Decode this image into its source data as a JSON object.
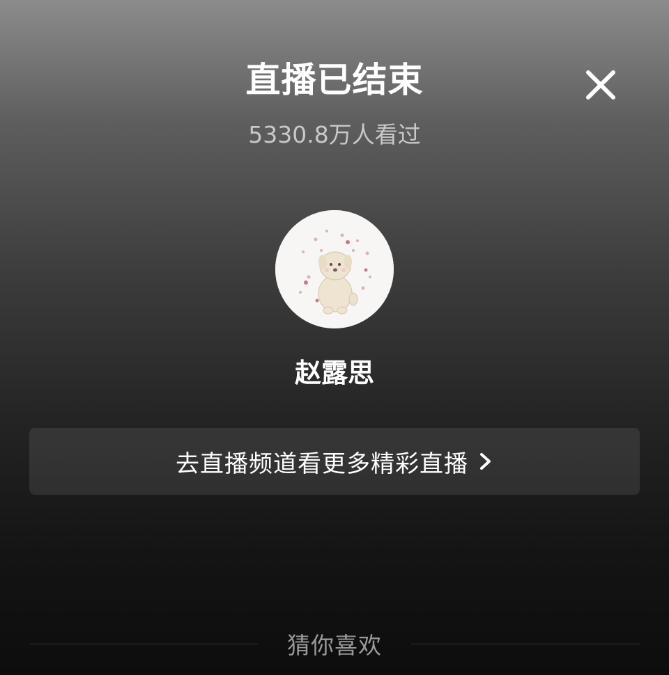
{
  "header": {
    "title": "直播已结束",
    "viewers": "5330.8万人看过",
    "close_icon": "close-icon"
  },
  "streamer": {
    "name": "赵露思",
    "avatar_icon": "avatar-illustration-dog"
  },
  "channel_button": {
    "label": "去直播频道看更多精彩直播",
    "icon": "chevron-right-icon"
  },
  "recommend": {
    "label": "猜你喜欢"
  },
  "colors": {
    "background_top": "#8c8c8c",
    "background_bottom": "#0d0d0d",
    "subtitle": "#c8c8c8",
    "section_label": "#9a9a9a"
  }
}
